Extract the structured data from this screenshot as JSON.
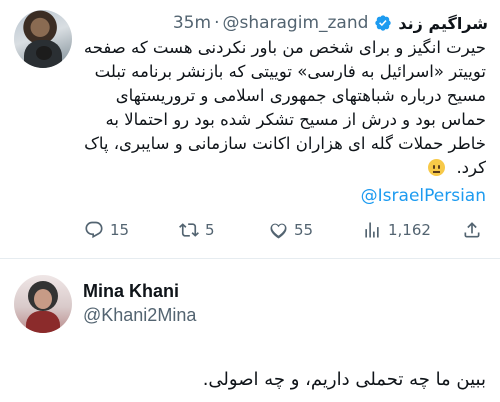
{
  "tweet": {
    "author_name": "شراگیم زند",
    "handle": "@sharagim_zand",
    "separator": "·",
    "time": "35m",
    "text": "حیرت انگیز و برای شخص من باور نکردنی هست که صفحه توییتر «اسرائیل به فارسی» توییتی که بازنشر برنامه تبلت مسیح درباره شباهتهای جمهوری اسلامی و تروریستهای حماس بود و درش از مسیح تشکر شده بود رو احتمالا به خاطر حملات گله ای هزاران اکانت سازمانی و سایبری، پاک کرد.",
    "emoji": "neutral-face-emoji",
    "mention": "@IsraelPersian",
    "actions": {
      "replies": "15",
      "retweets": "5",
      "likes": "55",
      "views": "1,162"
    }
  },
  "reply": {
    "author_name": "Mina Khani",
    "handle": "@Khani2Mina",
    "text": "ببین ما چه تحملی داریم، و چه اصولی."
  },
  "colors": {
    "accent": "#1d9bf0",
    "secondary_text": "#536471",
    "text": "#0f1419"
  }
}
